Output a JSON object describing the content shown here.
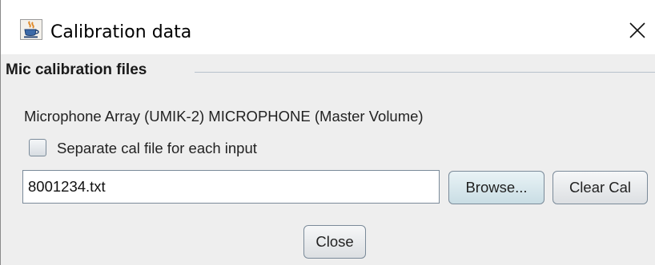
{
  "window": {
    "title": "Calibration data",
    "app_icon": "java-coffee-cup-icon",
    "close_icon": "close-icon"
  },
  "section": {
    "title": "Mic calibration files"
  },
  "device": {
    "label": "Microphone Array (UMIK-2) MICROPHONE (Master Volume)"
  },
  "separate_cal": {
    "label": "Separate cal file for each input",
    "checked": false
  },
  "cal_file": {
    "value": "8001234.txt"
  },
  "buttons": {
    "browse": "Browse...",
    "clear_cal": "Clear Cal",
    "close": "Close"
  },
  "colors": {
    "window_background": "#eeeeee",
    "titlebar_background": "#ffffff",
    "browse_button_tint": "#c9dde4",
    "section_line": "#b8c2cc"
  }
}
